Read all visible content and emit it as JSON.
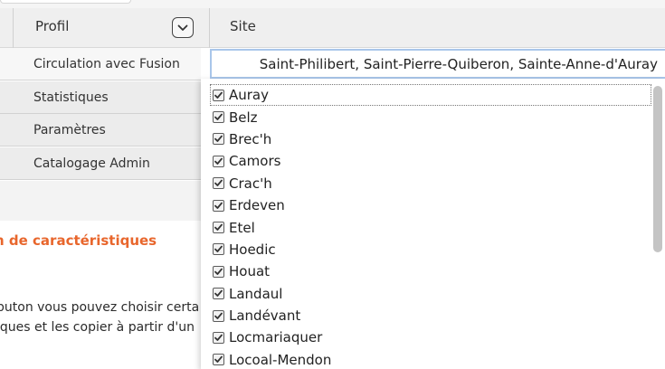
{
  "header": {
    "profil_label": "Profil",
    "site_label": "Site"
  },
  "menu": {
    "items": [
      {
        "label": "Circulation avec Fusion",
        "active": true
      },
      {
        "label": "Statistiques",
        "active": false
      },
      {
        "label": "Paramètres",
        "active": false
      },
      {
        "label": "Catalogage Admin",
        "active": false
      }
    ]
  },
  "content": {
    "section_title": "n de caractéristiques",
    "paragraph_line1": "buton vous pouvez choisir certa",
    "paragraph_line2": "iques et les copier à partir d'un"
  },
  "site_select": {
    "value": "Saint-Philibert, Saint-Pierre-Quiberon, Sainte-Anne-d'Auray",
    "options": [
      {
        "label": "Auray",
        "checked": true
      },
      {
        "label": "Belz",
        "checked": true
      },
      {
        "label": "Brec'h",
        "checked": true
      },
      {
        "label": "Camors",
        "checked": true
      },
      {
        "label": "Crac'h",
        "checked": true
      },
      {
        "label": "Erdeven",
        "checked": true
      },
      {
        "label": "Etel",
        "checked": true
      },
      {
        "label": "Hoedic",
        "checked": true
      },
      {
        "label": "Houat",
        "checked": true
      },
      {
        "label": "Landaul",
        "checked": true
      },
      {
        "label": "Landévant",
        "checked": true
      },
      {
        "label": "Locmariaquer",
        "checked": true
      },
      {
        "label": "Locoal-Mendon",
        "checked": true
      }
    ]
  },
  "icons": {
    "profil_toggle": "chevron-down-icon",
    "option_checkbox": "checkbox-checked-icon"
  },
  "colors": {
    "accent_orange": "#e8662c",
    "input_focus_border": "#a9c6ea"
  }
}
